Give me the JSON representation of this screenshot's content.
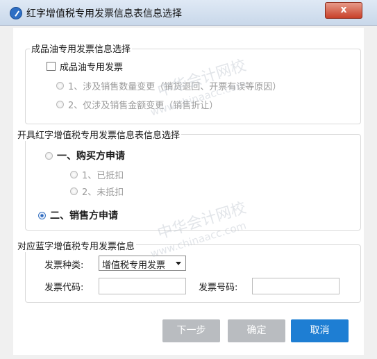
{
  "window": {
    "title": "红字增值税专用发票信息表信息选择",
    "close_label": "x"
  },
  "group1": {
    "legend": "成品油专用发票信息选择",
    "checkbox_label": "成品油专用发票",
    "option1": "1、涉及销售数量变更（销货退回、开票有误等原因）",
    "option2": "2、仅涉及销售金额变更（销售折让）"
  },
  "group2": {
    "legend": "开具红字增值税专用发票信息表信息选择",
    "buyer_label": "一、购买方申请",
    "buyer_opt1": "1、已抵扣",
    "buyer_opt2": "2、未抵扣",
    "seller_label": "二、销售方申请"
  },
  "group3": {
    "legend": "对应蓝字增值税专用发票信息",
    "type_label": "发票种类:",
    "type_value": "增值税专用发票",
    "code_label": "发票代码:",
    "code_value": "",
    "number_label": "发票号码:",
    "number_value": ""
  },
  "buttons": {
    "next": "下一步",
    "ok": "确定",
    "cancel": "取消"
  },
  "watermark": {
    "text1": "中华会计网校",
    "text2": "www.chinaacc.com"
  },
  "colors": {
    "accent": "#1e7ed3",
    "disabled": "#b9bcc0",
    "close": "#c8412a"
  }
}
